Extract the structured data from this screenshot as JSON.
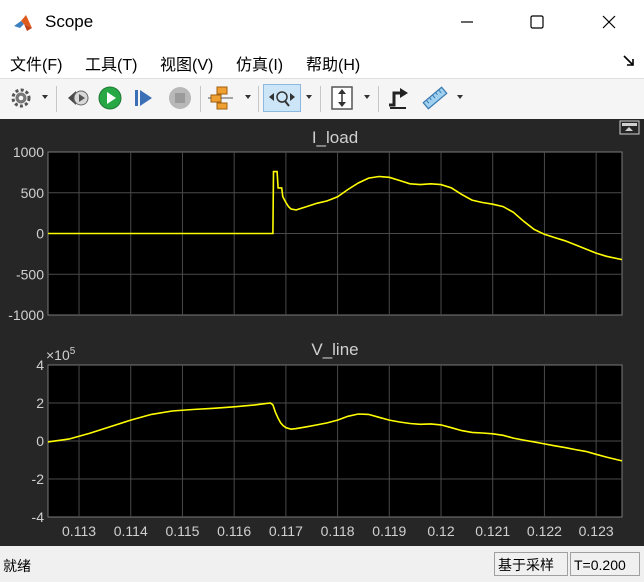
{
  "window": {
    "title": "Scope",
    "app_icon": "matlab-icon",
    "controls": [
      "minimize-icon",
      "maximize-icon",
      "close-icon"
    ]
  },
  "menu": {
    "items": [
      {
        "label": "文件(F)"
      },
      {
        "label": "工具(T)"
      },
      {
        "label": "视图(V)"
      },
      {
        "label": "仿真(I)"
      },
      {
        "label": "帮助(H)"
      }
    ]
  },
  "toolbar": {
    "icons": [
      "gear-icon",
      "step-back-icon",
      "run-icon",
      "step-forward-icon",
      "stop-icon",
      "signal-selector-icon",
      "zoom-axes-icon",
      "fit-to-view-icon",
      "triggers-icon",
      "cursor-measurements-icon"
    ]
  },
  "colors": {
    "plot_background": "#262626",
    "axes_background": "#000000",
    "grid": "#4a4a4a",
    "trace": "#ffff00",
    "axis_text": "#d0d0d0"
  },
  "chart_data": [
    {
      "type": "line",
      "title": "I_load",
      "xlabel": "",
      "ylabel": "",
      "xlim": [
        0.1124,
        0.1235
      ],
      "ylim": [
        -1000,
        1000
      ],
      "yticks": [
        "1000",
        "500",
        "0",
        "-500",
        "-1000"
      ],
      "grid": true,
      "series": [
        {
          "x": [
            0.1124,
            0.1167,
            0.11675,
            0.11676,
            0.11683,
            0.11685,
            0.11692,
            0.11694,
            0.117,
            0.11705,
            0.1171,
            0.1172,
            0.1174,
            0.1176,
            0.1178,
            0.118,
            0.1182,
            0.1184,
            0.1186,
            0.1188,
            0.119,
            0.1192,
            0.1194,
            0.1196,
            0.1198,
            0.12,
            0.1202,
            0.1204,
            0.1206,
            0.1208,
            0.121,
            0.1212,
            0.1214,
            0.1216,
            0.1218,
            0.122,
            0.1222,
            0.1224,
            0.1226,
            0.1228,
            0.123,
            0.1232,
            0.1235
          ],
          "y": [
            0,
            0,
            0,
            760,
            760,
            560,
            560,
            450,
            380,
            330,
            300,
            290,
            330,
            370,
            400,
            450,
            540,
            620,
            680,
            700,
            690,
            650,
            610,
            600,
            610,
            600,
            560,
            480,
            410,
            380,
            360,
            330,
            260,
            150,
            50,
            -10,
            -50,
            -90,
            -140,
            -190,
            -240,
            -280,
            -320
          ]
        }
      ]
    },
    {
      "type": "line",
      "title": "V_line",
      "xlabel": "",
      "ylabel": "",
      "exponent_label": "×10",
      "exponent": "5",
      "xlim": [
        0.1124,
        0.1235
      ],
      "ylim": [
        -400000,
        400000
      ],
      "yticks": [
        "4",
        "2",
        "0",
        "-2",
        "-4"
      ],
      "xticks": [
        "0.113",
        "0.114",
        "0.115",
        "0.116",
        "0.117",
        "0.118",
        "0.119",
        "0.12",
        "0.121",
        "0.122",
        "0.123"
      ],
      "grid": true,
      "series": [
        {
          "x": [
            0.1124,
            0.1128,
            0.1132,
            0.1136,
            0.114,
            0.1144,
            0.1148,
            0.1152,
            0.1156,
            0.116,
            0.1164,
            0.1167,
            0.11675,
            0.1168,
            0.11685,
            0.1169,
            0.11695,
            0.117,
            0.1171,
            0.1172,
            0.1174,
            0.1176,
            0.1178,
            0.118,
            0.1182,
            0.1184,
            0.1186,
            0.1188,
            0.119,
            0.1192,
            0.1194,
            0.1196,
            0.1198,
            0.12,
            0.1202,
            0.1204,
            0.1206,
            0.1208,
            0.121,
            0.1212,
            0.1214,
            0.1216,
            0.1218,
            0.122,
            0.1222,
            0.1224,
            0.1226,
            0.1228,
            0.123,
            0.1232,
            0.1235
          ],
          "y": [
            -5000,
            10000,
            40000,
            75000,
            110000,
            140000,
            158000,
            166000,
            172000,
            180000,
            190000,
            200000,
            190000,
            150000,
            120000,
            95000,
            80000,
            70000,
            62000,
            65000,
            75000,
            85000,
            95000,
            110000,
            130000,
            142000,
            140000,
            125000,
            110000,
            100000,
            92000,
            88000,
            90000,
            85000,
            70000,
            55000,
            45000,
            42000,
            38000,
            30000,
            15000,
            5000,
            -5000,
            -15000,
            -25000,
            -35000,
            -45000,
            -55000,
            -70000,
            -85000,
            -105000
          ]
        }
      ]
    }
  ],
  "status": {
    "left": "就绪",
    "mode": "基于采样",
    "time": "T=0.200"
  }
}
